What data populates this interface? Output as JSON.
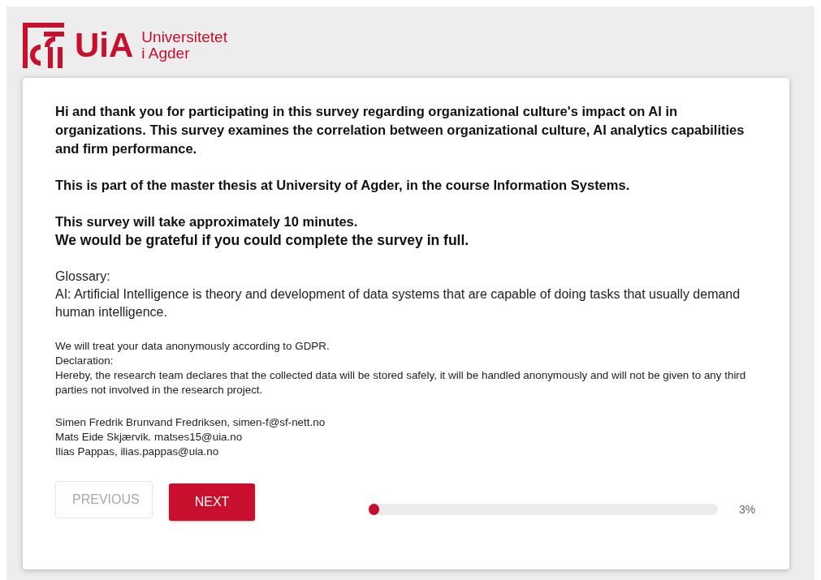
{
  "logo": {
    "abbreviation": "UiA",
    "name_lines": [
      "Universitetet",
      "i Agder"
    ]
  },
  "intro": [
    {
      "kind": "bold",
      "lines": [
        "Hi and thank you for participating in this survey regarding organizational culture's impact on AI in organizations. This survey examines the correlation between organizational culture, AI analytics capabilities and firm performance."
      ]
    },
    {
      "kind": "bold",
      "lines": [
        "This is part of the master thesis at University of Agder, in the course Information Systems."
      ]
    },
    {
      "kind": "bold",
      "lines": [
        "This survey will take approximately 10 minutes.",
        "We would be grateful if you could complete the survey in full."
      ]
    },
    {
      "kind": "normal",
      "lines": [
        "Glossary:",
        "AI: Artificial Intelligence is theory and development of data systems that are capable of doing tasks that usually demand human intelligence."
      ]
    },
    {
      "kind": "small",
      "lines": [
        "We will treat your data anonymously according to GDPR.",
        "Declaration:",
        "Hereby, the research team declares that the collected data will be stored safely, it will be handled anonymously and will not be given to any third parties not involved in the research project."
      ]
    },
    {
      "kind": "small",
      "lines": [
        "Simen Fredrik Brunvand Fredriksen, simen-f@sf-nett.no",
        "Mats Eide Skjærvik. matses15@uia.no",
        "Ilias Pappas, ilias.pappas@uia.no"
      ]
    }
  ],
  "buttons": [
    {
      "label": "PREVIOUS",
      "kind": "previous",
      "disabled": true
    },
    {
      "label": "NEXT",
      "kind": "next",
      "disabled": false
    }
  ],
  "progress": {
    "level": 0.03,
    "reading": "3%"
  }
}
